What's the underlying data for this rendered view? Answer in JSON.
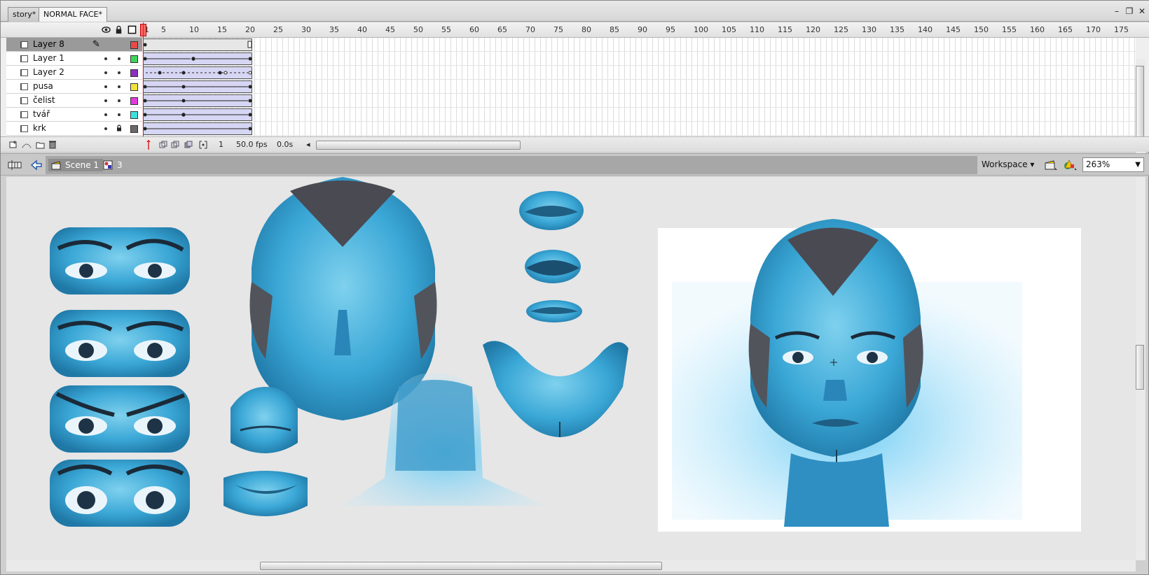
{
  "doc_tabs": [
    {
      "label": "story*",
      "active": false
    },
    {
      "label": "NORMAL FACE*",
      "active": true
    }
  ],
  "window_controls": {
    "minimize": "–",
    "restore": "❐",
    "close": "✕"
  },
  "timeline": {
    "ruler_ticks": [
      "1",
      "5",
      "10",
      "15",
      "20",
      "25",
      "30",
      "35",
      "40",
      "45",
      "50",
      "55",
      "60",
      "65",
      "70",
      "75",
      "80",
      "85",
      "90",
      "95",
      "100",
      "105",
      "110",
      "115",
      "120",
      "125",
      "130",
      "135",
      "140",
      "145",
      "150",
      "155",
      "160",
      "165",
      "170",
      "175"
    ],
    "layers": [
      {
        "name": "Layer 8",
        "color": "#e84a4a",
        "selected": true,
        "locked": false
      },
      {
        "name": "Layer 1",
        "color": "#3fd35c",
        "selected": false,
        "locked": false
      },
      {
        "name": "Layer 2",
        "color": "#8a2fc0",
        "selected": false,
        "locked": false
      },
      {
        "name": "pusa",
        "color": "#f0e43a",
        "selected": false,
        "locked": false
      },
      {
        "name": "čelist",
        "color": "#e43ae0",
        "selected": false,
        "locked": false
      },
      {
        "name": "tvář",
        "color": "#3ae0e0",
        "selected": false,
        "locked": false
      },
      {
        "name": "krk",
        "color": "#6a6a6a",
        "selected": false,
        "locked": true
      }
    ],
    "footer": {
      "current_frame": "1",
      "fps": "50.0 fps",
      "time": "0.0s"
    }
  },
  "edit_bar": {
    "scene_label": "Scene 1",
    "symbol_label": "3",
    "workspace_label": "Workspace ▾",
    "zoom_value": "263%"
  }
}
